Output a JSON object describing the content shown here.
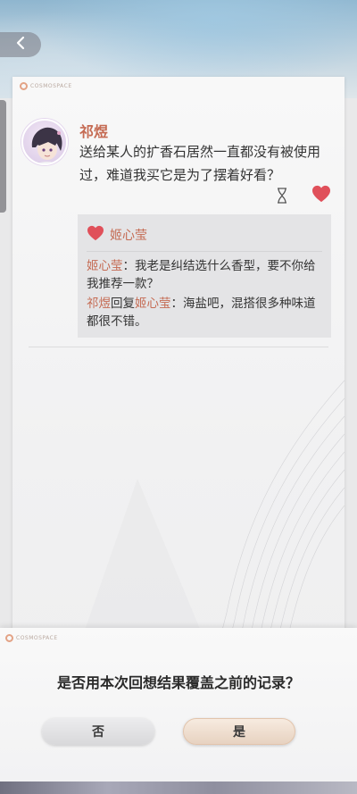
{
  "header": {
    "back_icon": "chevron-left-icon"
  },
  "card": {
    "logo_text": "COSMOSPACE",
    "post": {
      "author": "祁煜",
      "text": "送给某人的扩香石居然一直都没有被使用过，难道我买它是为了摆着好看？",
      "hourglass_icon": "hourglass-icon",
      "like_icon": "heart-icon",
      "like_color": "#e0505a"
    },
    "likes": {
      "names": "姬心莹"
    },
    "comments": [
      {
        "author": "姬心莹",
        "separator": "：",
        "text": "我老是纠结选什么香型，要不你给我推荐一款？"
      },
      {
        "author": "祁煜",
        "reply_word": "回复",
        "reply_to": "姬心莹",
        "separator": "：",
        "text": "海盐吧，混搭很多种味道都很不错。"
      }
    ]
  },
  "dialog": {
    "logo_text": "COSMOSPACE",
    "question": "是否用本次回想结果覆盖之前的记录？",
    "no_label": "否",
    "yes_label": "是"
  },
  "colors": {
    "accent": "#c56b53",
    "heart": "#e0505a"
  }
}
